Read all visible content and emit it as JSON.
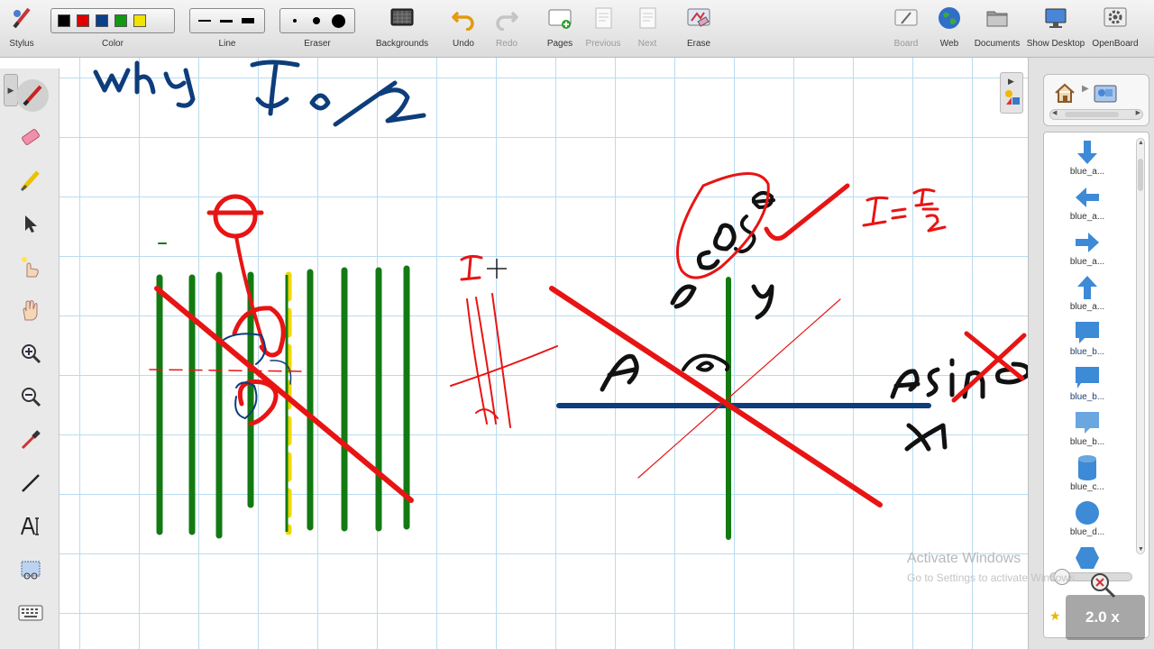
{
  "toolbar": {
    "stylus": "Stylus",
    "color": "Color",
    "line": "Line",
    "eraser": "Eraser",
    "backgrounds": "Backgrounds",
    "undo": "Undo",
    "redo": "Redo",
    "pages": "Pages",
    "previous": "Previous",
    "next": "Next",
    "erase": "Erase",
    "board": "Board",
    "web": "Web",
    "documents": "Documents",
    "show_desktop": "Show Desktop",
    "openboard": "OpenBoard",
    "colors": [
      "#000000",
      "#e00000",
      "#0a3f8a",
      "#119911",
      "#f2e200"
    ]
  },
  "left_tools": [
    "pen-icon",
    "eraser-icon",
    "marker-icon",
    "pointer-icon",
    "laser-pointer-icon",
    "hand-icon",
    "zoom-in-icon",
    "zoom-out-icon",
    "pipette-icon",
    "line-tool-icon",
    "text-tool-icon",
    "capture-icon",
    "keyboard-icon"
  ],
  "library": {
    "items": [
      {
        "label": "blue_a..."
      },
      {
        "label": "blue_a..."
      },
      {
        "label": "blue_a..."
      },
      {
        "label": "blue_a..."
      },
      {
        "label": "blue_b..."
      },
      {
        "label": "blue_b..."
      },
      {
        "label": "blue_b..."
      },
      {
        "label": "blue_c..."
      },
      {
        "label": "blue_d..."
      }
    ]
  },
  "zoom": "2.0 x",
  "watermark": {
    "line1": "Activate Windows",
    "line2": "Go to Settings to activate Windows."
  },
  "colors": {
    "ink_blue": "#0d3d7a",
    "ink_red": "#e81414",
    "ink_green": "#137a13",
    "ink_yellow": "#f0d800",
    "grid": "#b9dcef"
  }
}
